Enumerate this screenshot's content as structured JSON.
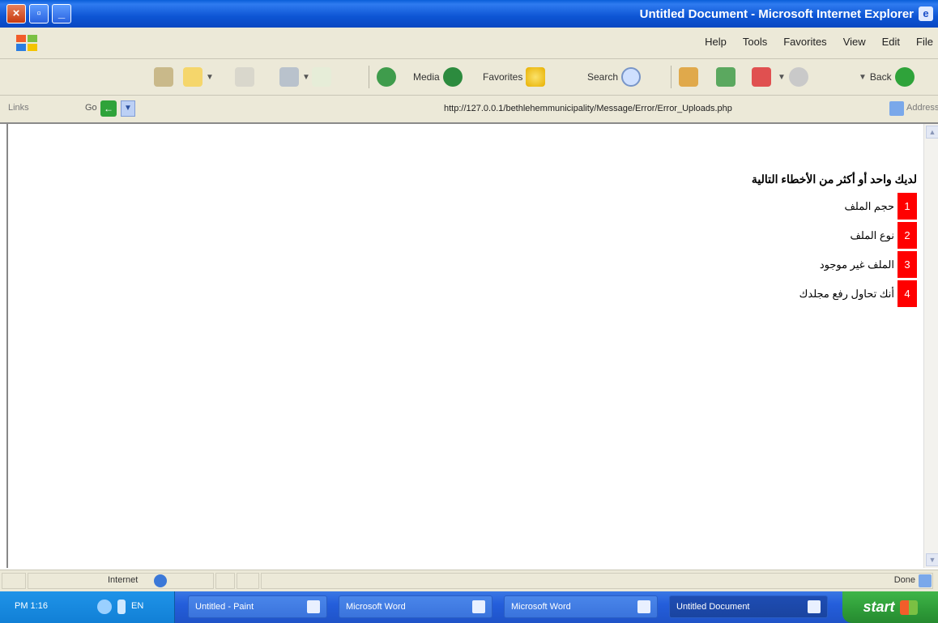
{
  "window": {
    "title": "Untitled Document - Microsoft Internet Explorer",
    "controls": [
      "close",
      "maximize",
      "minimize"
    ]
  },
  "menu": {
    "items": [
      "File",
      "Edit",
      "View",
      "Favorites",
      "Tools",
      "Help"
    ]
  },
  "toolbar": {
    "back_label": "Back",
    "search_label": "Search",
    "favorites_label": "Favorites",
    "media_label": "Media"
  },
  "address": {
    "links_label": "Links",
    "go_label": "Go",
    "url": "http://127.0.0.1/bethlehemmunicipality/Message/Error/Error_Uploads.php",
    "address_label": "Address"
  },
  "content": {
    "heading": "لديك واحد أو أكثر من الأخطاء التالية",
    "errors": [
      {
        "number": "1",
        "text": "حجم الملف"
      },
      {
        "number": "2",
        "text": "نوع الملف"
      },
      {
        "number": "3",
        "text": "الملف غير موجود"
      },
      {
        "number": "4",
        "text": "أنك تحاول رفع مجلدك"
      }
    ]
  },
  "status": {
    "zone": "Internet",
    "state": "Done"
  },
  "taskbar": {
    "time": "PM 1:16",
    "lang": "EN",
    "tasks": [
      {
        "label": "Untitled Document",
        "active": true
      },
      {
        "label": "Microsoft Word",
        "active": false
      },
      {
        "label": "Microsoft Word",
        "active": false
      },
      {
        "label": "Untitled - Paint",
        "active": false
      }
    ],
    "start_label": "start"
  },
  "colors": {
    "titlebar": "#0d55d4",
    "error_number_bg": "#ff0000",
    "start_button": "#2e9b38"
  }
}
